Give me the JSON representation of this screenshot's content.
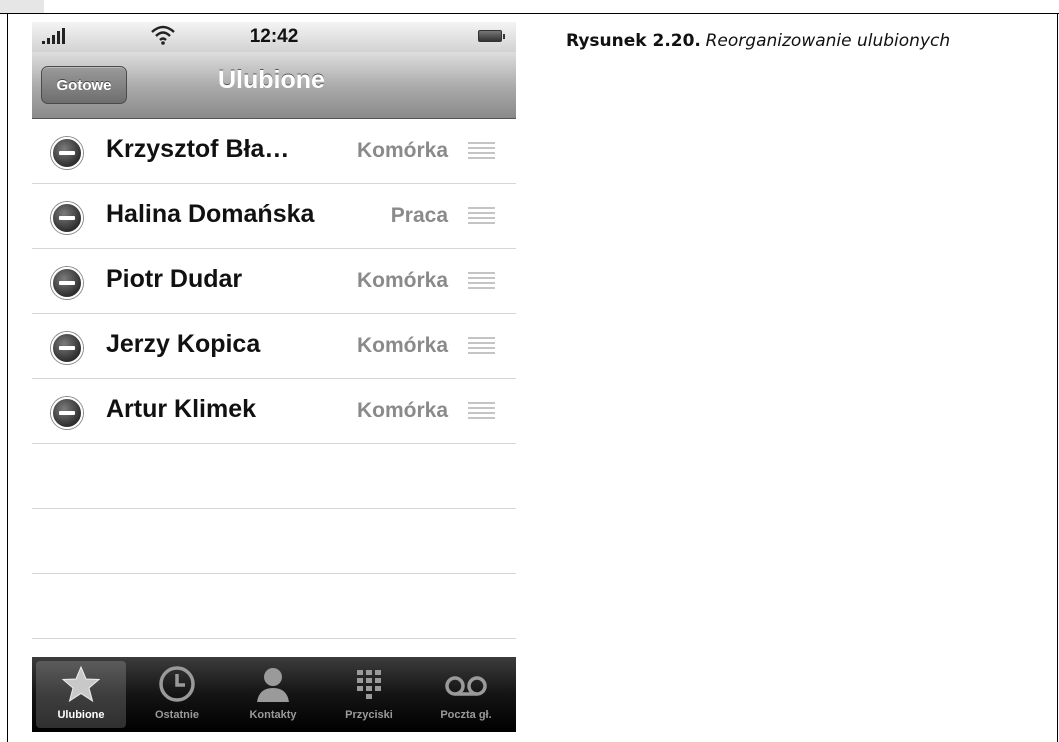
{
  "status_bar": {
    "time": "12:42"
  },
  "navbar": {
    "done_label": "Gotowe",
    "title": "Ulubione"
  },
  "favorites": [
    {
      "name": "Krzysztof Bła…",
      "label": "Komórka"
    },
    {
      "name": "Halina Domańska",
      "label": "Praca"
    },
    {
      "name": "Piotr Dudar",
      "label": "Komórka"
    },
    {
      "name": "Jerzy Kopica",
      "label": "Komórka"
    },
    {
      "name": "Artur Klimek",
      "label": "Komórka"
    }
  ],
  "tabbar": {
    "active": "Ulubione",
    "tabs": [
      {
        "label": "Ulubione",
        "icon": "star-icon"
      },
      {
        "label": "Ostatnie",
        "icon": "clock-icon"
      },
      {
        "label": "Kontakty",
        "icon": "person-icon"
      },
      {
        "label": "Przyciski",
        "icon": "keypad-icon"
      },
      {
        "label": "Poczta gł.",
        "icon": "voicemail-icon"
      }
    ]
  },
  "caption": {
    "figure": "Rysunek 2.20.",
    "text": "Reorganizowanie ulubionych"
  }
}
